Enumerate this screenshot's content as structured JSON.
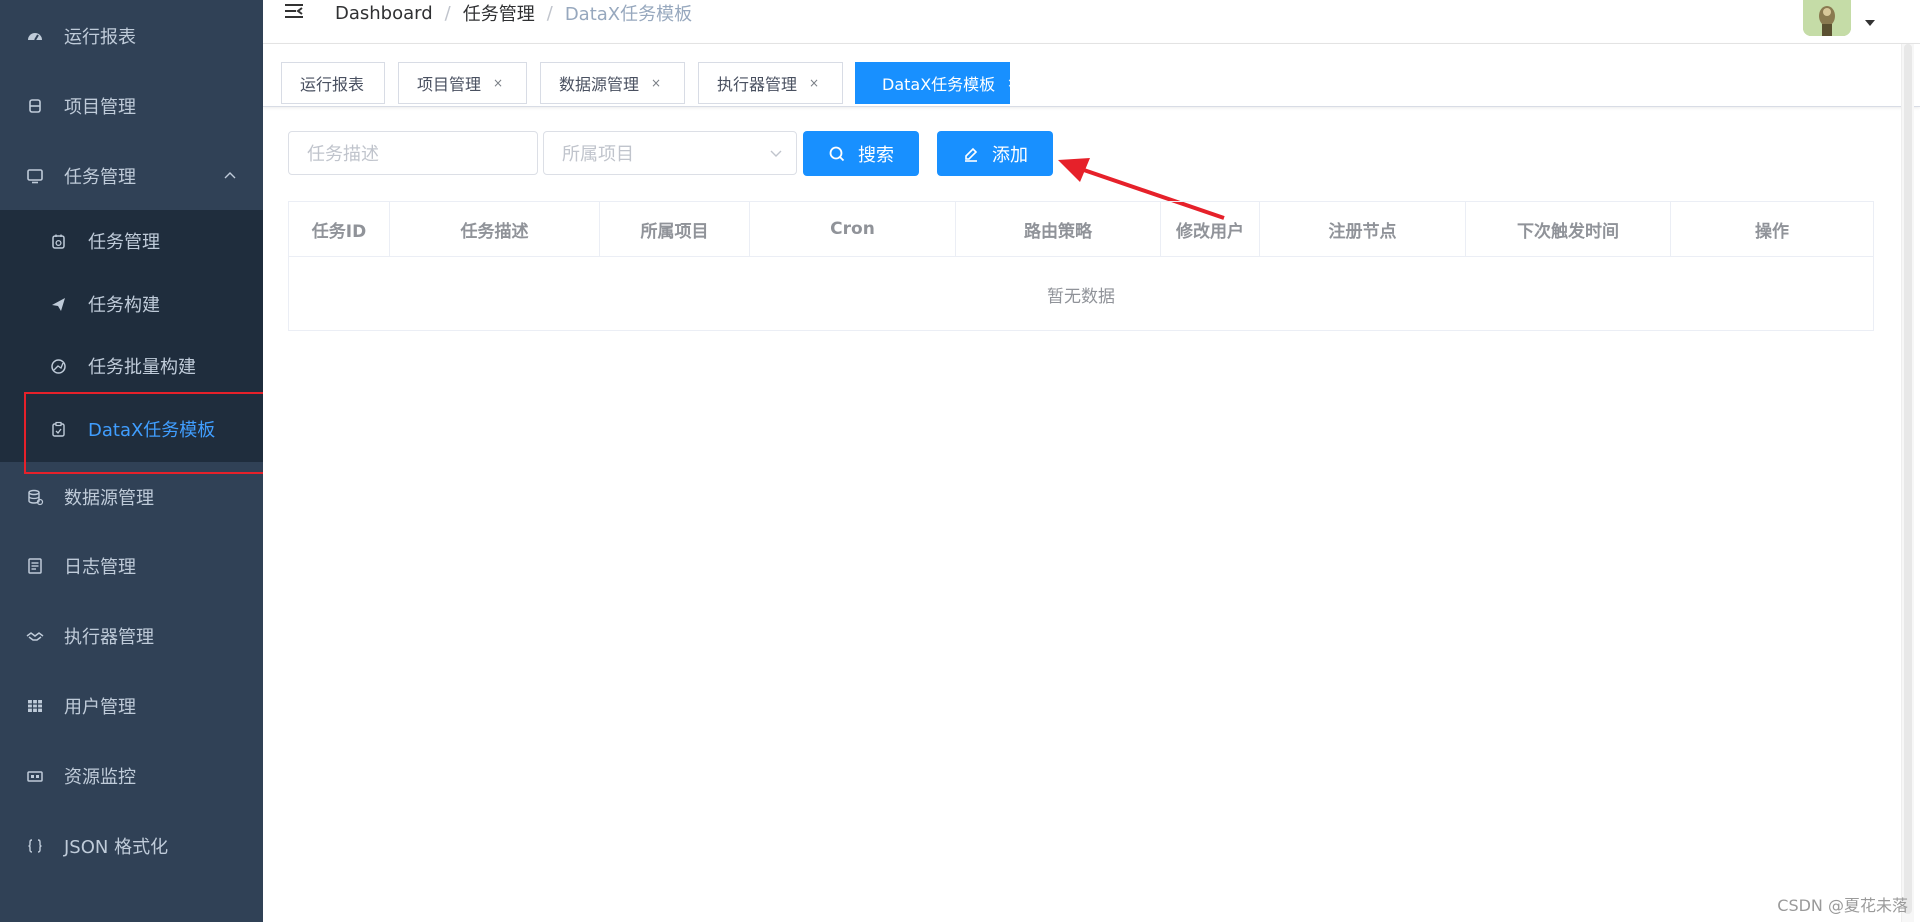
{
  "sidebar": {
    "items": [
      {
        "label": "运行报表",
        "icon": "dashboard-icon"
      },
      {
        "label": "项目管理",
        "icon": "database-icon"
      },
      {
        "label": "任务管理",
        "icon": "monitor-icon"
      },
      {
        "label": "数据源管理",
        "icon": "datasource-icon"
      },
      {
        "label": "日志管理",
        "icon": "log-icon"
      },
      {
        "label": "执行器管理",
        "icon": "executor-icon"
      },
      {
        "label": "用户管理",
        "icon": "table-icon"
      },
      {
        "label": "资源监控",
        "icon": "monitor-resource-icon"
      },
      {
        "label": "JSON 格式化",
        "icon": "braces-icon"
      }
    ],
    "sub_items": [
      {
        "label": "任务管理",
        "icon": "clipboard-icon"
      },
      {
        "label": "任务构建",
        "icon": "send-icon"
      },
      {
        "label": "任务批量构建",
        "icon": "globe-icon"
      },
      {
        "label": "DataX任务模板",
        "icon": "template-icon"
      }
    ]
  },
  "header": {
    "breadcrumb": [
      "Dashboard",
      "任务管理",
      "DataX任务模板"
    ],
    "separator": "/"
  },
  "tags": [
    {
      "label": "运行报表",
      "close": ""
    },
    {
      "label": "项目管理",
      "close": "×"
    },
    {
      "label": "数据源管理",
      "close": "×"
    },
    {
      "label": "执行器管理",
      "close": "×"
    },
    {
      "label": "DataX任务模板",
      "close": "×"
    }
  ],
  "filters": {
    "task_desc_placeholder": "任务描述",
    "project_placeholder": "所属项目",
    "search_label": "搜索",
    "add_label": "添加"
  },
  "table": {
    "columns": [
      "任务ID",
      "任务描述",
      "所属项目",
      "Cron",
      "路由策略",
      "修改用户",
      "注册节点",
      "下次触发时间",
      "操作"
    ],
    "empty_text": "暂无数据"
  },
  "colors": {
    "sidebar_bg": "#304156",
    "submenu_bg": "#1f2d3d",
    "primary": "#1890ff",
    "active_menu_text": "#409eff",
    "annotation_red": "#e6212a"
  },
  "watermark": "CSDN @夏花未落"
}
